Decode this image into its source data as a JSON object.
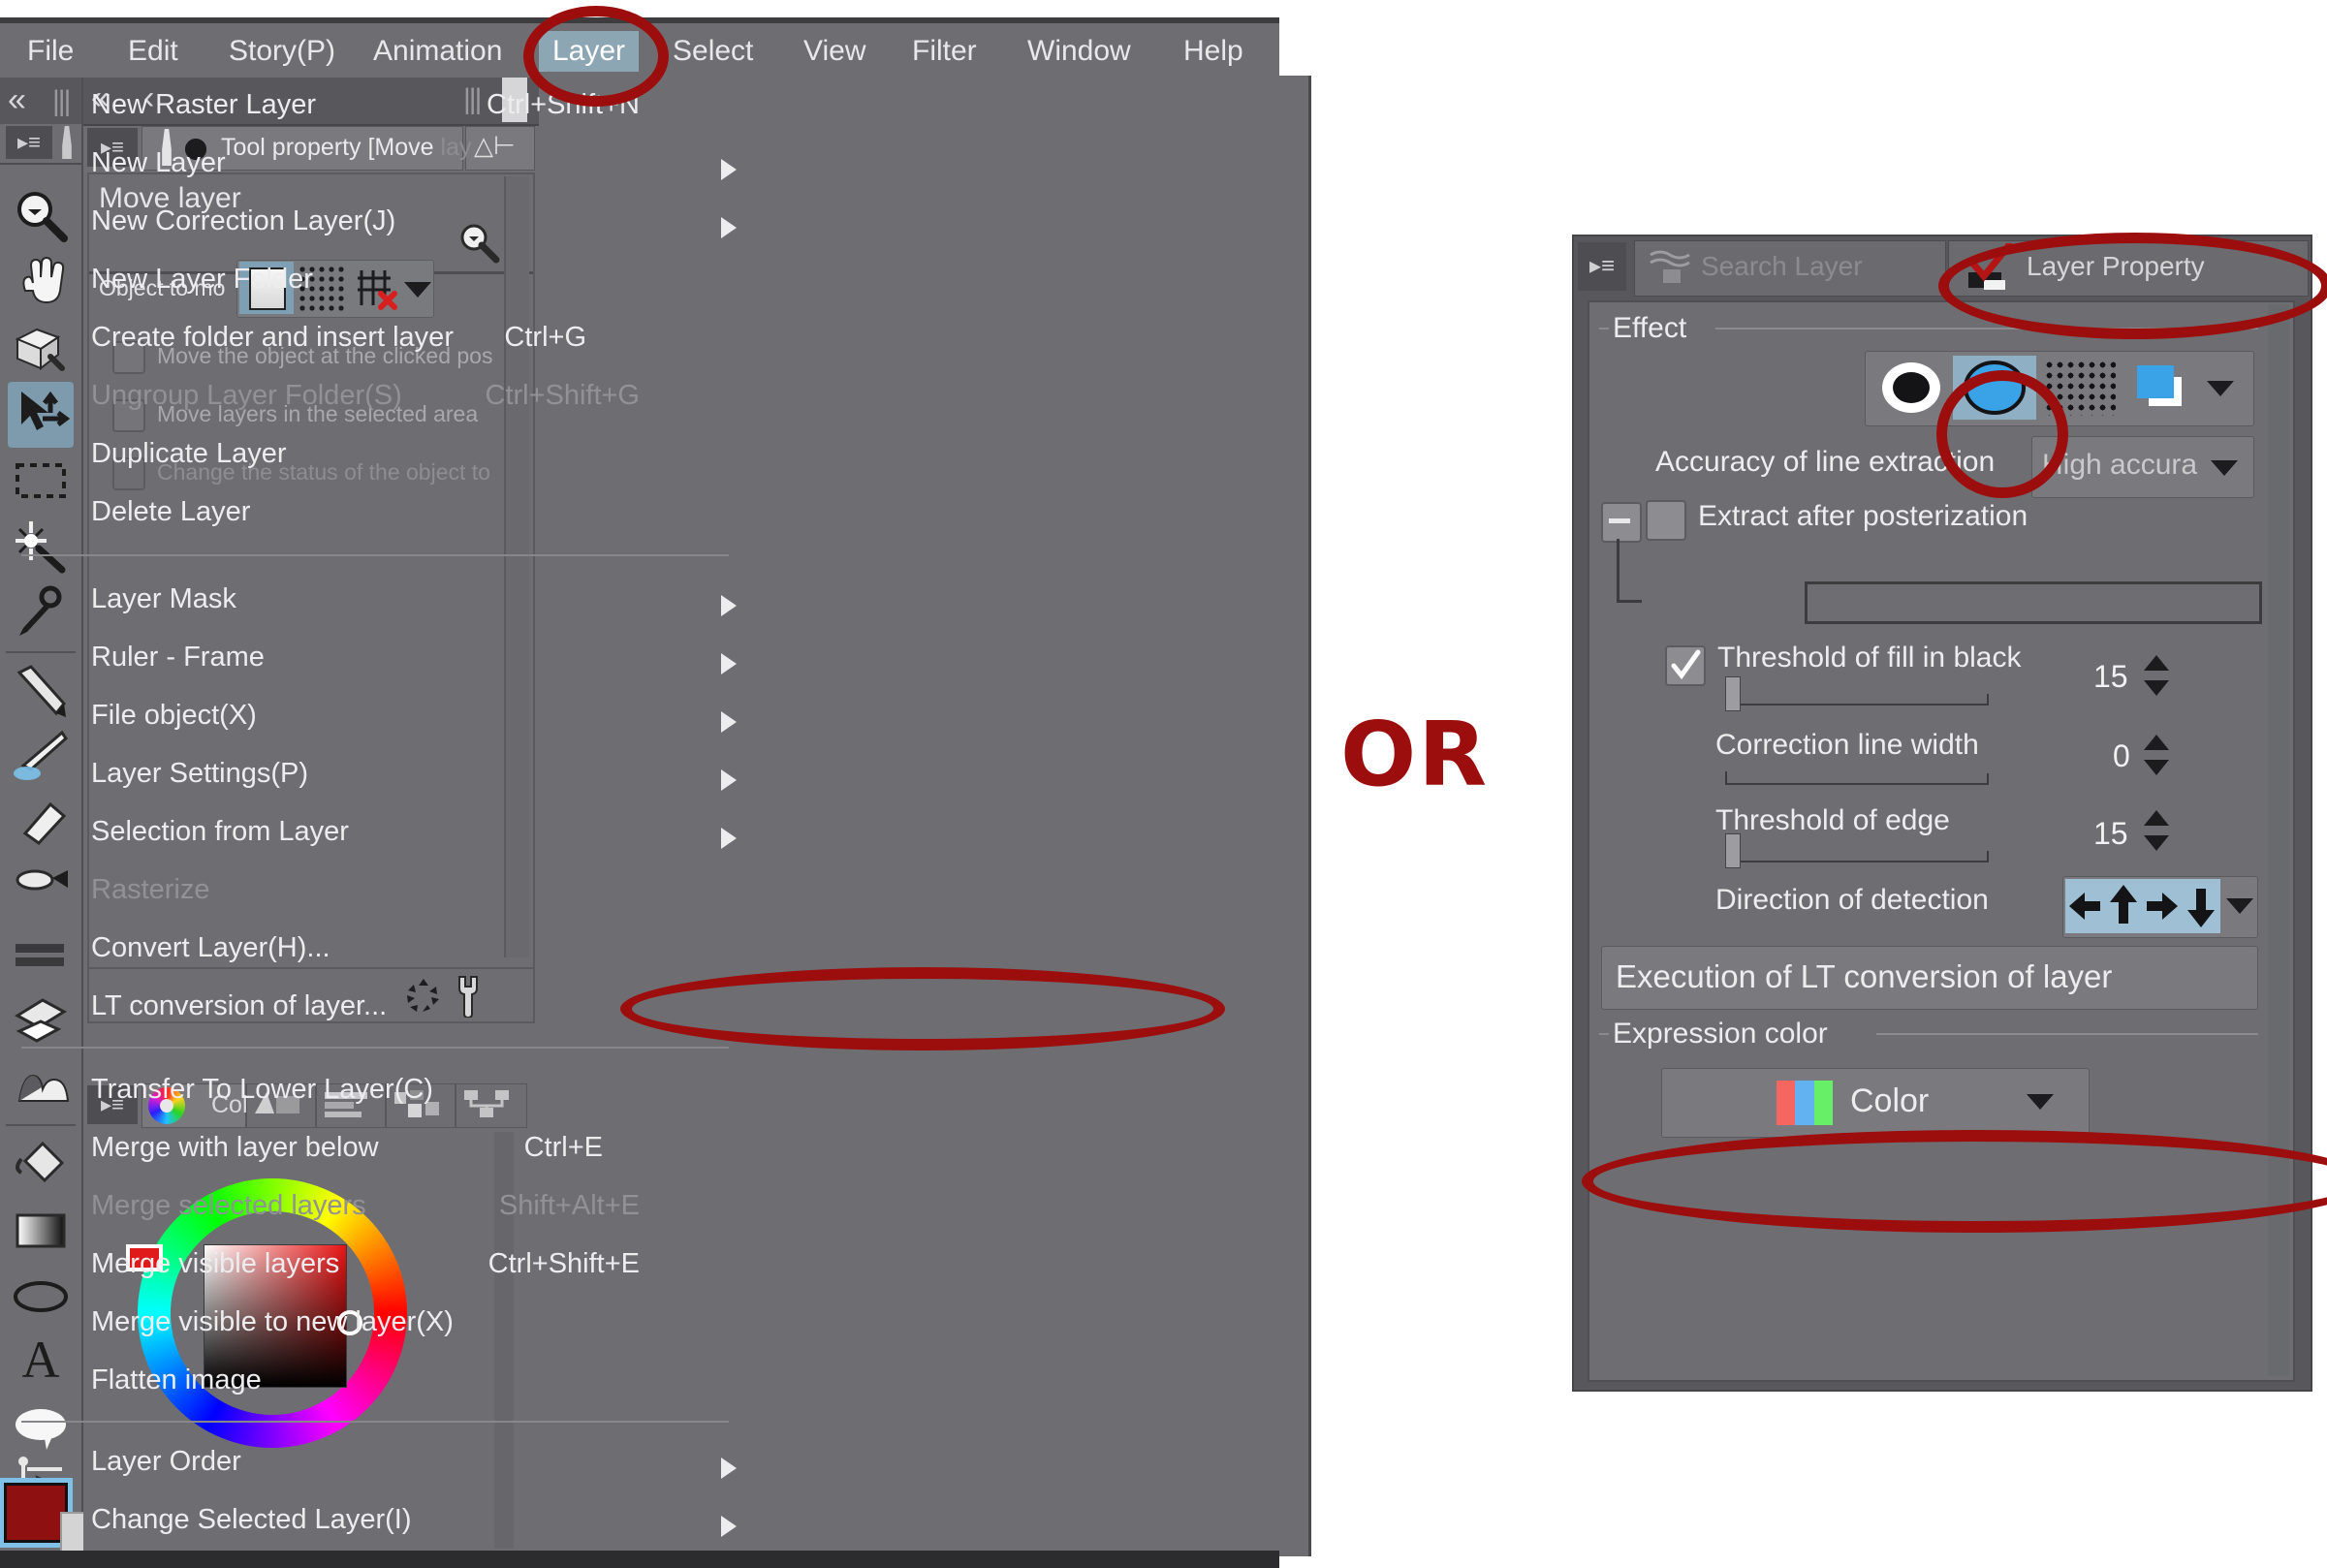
{
  "app": {
    "menubar": [
      {
        "label": "File",
        "active": false
      },
      {
        "label": "Edit",
        "active": false
      },
      {
        "label": "Story(P)",
        "active": false
      },
      {
        "label": "Animation",
        "active": false
      },
      {
        "label": "Layer",
        "active": true
      },
      {
        "label": "Select",
        "active": false
      },
      {
        "label": "View",
        "active": false
      },
      {
        "label": "Filter",
        "active": false
      },
      {
        "label": "Window",
        "active": false
      },
      {
        "label": "Help",
        "active": false
      }
    ]
  },
  "tool_property": {
    "tab_title": "Tool property [Move ",
    "tab_title_dim": "lay",
    "tool_name": "Move layer",
    "object_to_move_label": "Object to mo",
    "options": [
      {
        "label": "Move the object at the clicked pos",
        "checked": false,
        "disabled": false
      },
      {
        "label": "Move layers in the selected area",
        "checked": false,
        "disabled": false
      },
      {
        "label": "Change the status of the object to",
        "checked": false,
        "disabled": true
      }
    ]
  },
  "color_panel": {
    "tab_label": "Col",
    "wheel_color": "#e81414"
  },
  "tool_rail": {
    "icons": [
      "zoom-icon",
      "hand-icon",
      "rotate-icon",
      "move-layer-icon",
      "marquee-icon",
      "auto-select-icon",
      "eyedropper-icon",
      "pen-icon",
      "brush-icon",
      "eraser-icon",
      "airbrush-icon",
      "gradient-bar-icon",
      "blend-icon",
      "blur-icon",
      "fill-bucket-icon",
      "gradient-icon",
      "ellipse-icon",
      "text-icon",
      "balloon-icon",
      "correct-line-icon"
    ],
    "foreground_color": "#8f1010"
  },
  "layer_menu": {
    "items": [
      {
        "label": "New Raster Layer",
        "shortcut": "Ctrl+Shift+N",
        "submenu": false,
        "disabled": false
      },
      {
        "label": "New Layer",
        "shortcut": "",
        "submenu": true,
        "disabled": false
      },
      {
        "label": "New Correction Layer(J)",
        "shortcut": "",
        "submenu": true,
        "disabled": false
      },
      {
        "label": "New Layer Folder",
        "shortcut": "",
        "submenu": false,
        "disabled": false
      },
      {
        "label": "Create folder and insert layer",
        "shortcut": "Ctrl+G",
        "submenu": false,
        "disabled": false
      },
      {
        "label": "Ungroup Layer Folder(S)",
        "shortcut": "Ctrl+Shift+G",
        "submenu": false,
        "disabled": true
      },
      {
        "label": "Duplicate Layer",
        "shortcut": "",
        "submenu": false,
        "disabled": false
      },
      {
        "label": "Delete Layer",
        "shortcut": "",
        "submenu": false,
        "disabled": false
      },
      {
        "label": "Layer Mask",
        "shortcut": "",
        "submenu": true,
        "disabled": false
      },
      {
        "label": "Ruler - Frame",
        "shortcut": "",
        "submenu": true,
        "disabled": false
      },
      {
        "label": "File object(X)",
        "shortcut": "",
        "submenu": true,
        "disabled": false
      },
      {
        "label": "Layer Settings(P)",
        "shortcut": "",
        "submenu": true,
        "disabled": false
      },
      {
        "label": "Selection from Layer",
        "shortcut": "",
        "submenu": true,
        "disabled": false
      },
      {
        "label": "Rasterize",
        "shortcut": "",
        "submenu": false,
        "disabled": true
      },
      {
        "label": "Convert Layer(H)...",
        "shortcut": "",
        "submenu": false,
        "disabled": false
      },
      {
        "label": "LT conversion of layer...",
        "shortcut": "",
        "submenu": false,
        "disabled": false
      },
      {
        "label": "Transfer To Lower Layer(C)",
        "shortcut": "",
        "submenu": false,
        "disabled": false
      },
      {
        "label": "Merge with layer below",
        "shortcut": "Ctrl+E",
        "submenu": false,
        "disabled": false
      },
      {
        "label": "Merge selected layers",
        "shortcut": "Shift+Alt+E",
        "submenu": false,
        "disabled": true
      },
      {
        "label": "Merge visible layers",
        "shortcut": "Ctrl+Shift+E",
        "submenu": false,
        "disabled": false
      },
      {
        "label": "Merge visible to new layer(X)",
        "shortcut": "",
        "submenu": false,
        "disabled": false
      },
      {
        "label": "Flatten image",
        "shortcut": "",
        "submenu": false,
        "disabled": false
      },
      {
        "label": "Layer Order",
        "shortcut": "",
        "submenu": true,
        "disabled": false
      },
      {
        "label": "Change Selected Layer(I)",
        "shortcut": "",
        "submenu": true,
        "disabled": false
      }
    ]
  },
  "connector": {
    "or_text": "OR"
  },
  "layer_property": {
    "tabs": [
      {
        "label": "Search Layer",
        "active": false
      },
      {
        "label": "Layer Property",
        "active": true
      }
    ],
    "effect_group": "Effect",
    "effect_modes": [
      "border-effect-icon",
      "extract-line-icon",
      "tone-icon",
      "layer-color-icon"
    ],
    "effect_selected_index": 1,
    "accuracy_label": "Accuracy of line extraction",
    "accuracy_value": "High accura",
    "posterization_label": "Extract after posterization",
    "posterization_checked": false,
    "rows": [
      {
        "label": "Threshold of fill in black",
        "value": "15",
        "checkbox": true,
        "checked": true,
        "slider": 4
      },
      {
        "label": "Correction line width",
        "value": "0",
        "checkbox": false,
        "checked": false,
        "slider": 0
      },
      {
        "label": "Threshold of edge",
        "value": "15",
        "checkbox": false,
        "checked": false,
        "slider": 4
      }
    ],
    "direction_label": "Direction of detection",
    "direction_icons": [
      "arrow-left-icon",
      "arrow-up-icon",
      "arrow-right-icon",
      "arrow-down-icon"
    ],
    "execute_button": "Execution of LT conversion of layer",
    "expression_group": "Expression color",
    "expression_value": "Color"
  },
  "annotations": {
    "highlight_color": "#9c0d0d",
    "targets": [
      "layer-menu-button",
      "lt-conversion-menu-item",
      "layer-property-tab",
      "extract-line-effect-button",
      "execute-lt-conversion-button"
    ]
  }
}
